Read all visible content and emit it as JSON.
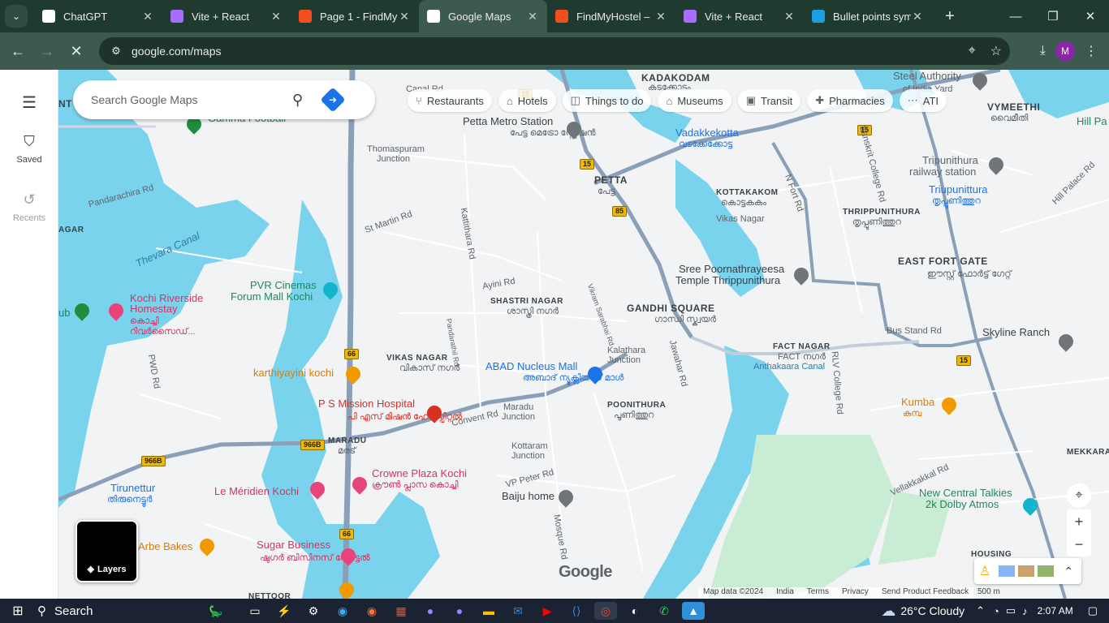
{
  "browser": {
    "tabs": [
      {
        "title": "ChatGPT",
        "favicon": "chatgpt-icon",
        "color": "#ffffff",
        "active": false
      },
      {
        "title": "Vite + React",
        "favicon": "vite-icon",
        "color": "#a86bff",
        "active": false
      },
      {
        "title": "Page 1 - FindMy",
        "favicon": "figma-icon",
        "color": "#f24e1e",
        "active": false
      },
      {
        "title": "Google Maps",
        "favicon": "maps-icon",
        "color": "#ffffff",
        "active": true
      },
      {
        "title": "FindMyHostel –",
        "favicon": "figma-icon",
        "color": "#f24e1e",
        "active": false
      },
      {
        "title": "Vite + React",
        "favicon": "vite-icon",
        "color": "#a86bff",
        "active": false
      },
      {
        "title": "Bullet points sym",
        "favicon": "s-icon",
        "color": "#1ba1e2",
        "active": false
      }
    ],
    "url": "google.com/maps",
    "profile_initial": "M"
  },
  "sidebar": {
    "saved_label": "Saved",
    "recents_label": "Recents"
  },
  "search": {
    "placeholder": "Search Google Maps"
  },
  "chips": [
    {
      "label": "Restaurants",
      "icon": "fork-knife-icon"
    },
    {
      "label": "Hotels",
      "icon": "bed-icon"
    },
    {
      "label": "Things to do",
      "icon": "camera-icon"
    },
    {
      "label": "Museums",
      "icon": "museum-icon"
    },
    {
      "label": "Transit",
      "icon": "train-icon"
    },
    {
      "label": "Pharmacies",
      "icon": "pill-icon"
    },
    {
      "label": "ATI",
      "icon": "dots-icon"
    }
  ],
  "map_labels": {
    "kadakodam": "KADAKODAM",
    "kadakodam_ml": "കടക്കോടം",
    "steel_authority": "Steel Authority",
    "steel_authority2": "of India Yard",
    "vymeethi": "VYMEETHI",
    "vymeethi_ml": "വൈമീതി",
    "hill_pa": "Hill Pa",
    "canal_rd": "Canal Rd",
    "petta_metro": "Petta Metro Station",
    "petta_metro_ml": "പേട്ട മെട്രോ സ്റ്റേഷൻ",
    "vadakkekotta": "Vadakkekotta",
    "vadakkekotta_ml": "വടക്കേക്കോട്ട",
    "gamma_football": "Gamma Football",
    "thomaspuram": "Thomaspuram",
    "junction": "Junction",
    "petta": "PETTA",
    "petta_ml": "പേട്ട",
    "kottakakom": "KOTTAKAKOM",
    "kottakakom_ml": "കൊട്ടകകം",
    "tripunithura_rly": "Tripunithura",
    "railway_station": "railway station",
    "tripunittura": "Triupunittura",
    "tripunittura_ml": "തൃപ്പൂണിത്തുറ",
    "thrippunithura": "THRIPPUNITHURA",
    "thrippunithura_ml": "തൃപ്പൂണിത്തുറ",
    "pandarachira": "Pandarachira Rd",
    "thevara_canal": "Thevara Canal",
    "east_fort_gate": "EAST FORT GATE",
    "east_fort_gate_ml": "ഈസ്റ്റ് ഫോർട്ട് ഗേറ്റ്",
    "sree_poornathrayeesa": "Sree Poornathrayeesa",
    "temple_thrippunithura": "Temple Thrippunithura",
    "pvr_cinemas": "PVR Cinemas",
    "forum_mall": "Forum Mall Kochi",
    "kochi_riverside": "Kochi Riverside",
    "homestay": "Homestay",
    "kochi_riverside_ml": "കൊച്ചി",
    "kochi_riverside_ml2": "റിവർസൈഡ്...",
    "shastri_nagar": "SHASTRI NAGAR",
    "shastri_nagar_ml": "ശാസ്ത്രി നഗർ",
    "gandhi_square": "GANDHI SQUARE",
    "gandhi_square_ml": "ഗാന്ധി സ്ക്വയർ",
    "bus_stand_rd": "Bus Stand Rd",
    "skyline_ranch": "Skyline Ranch",
    "fact_nagar": "FACT NAGAR",
    "fact_nagar_ml": "FACT നഗർ",
    "vikas_nagar": "VIKAS NAGAR",
    "vikas_nagar_ml": "വികാസ് നഗർ",
    "abad_nucleus": "ABAD Nucleus Mall",
    "abad_nucleus_ml": "അബാദ് ന്യൂക്ലിയസ് മാൾ",
    "kalathara": "Kalathara",
    "karthiyayini": "karthiyayini kochi",
    "ps_mission": "P S Mission Hospital",
    "ps_mission_ml": "പി എസ് മിഷൻ ഹോസ്പിറ്റൽ",
    "maradu_junction": "Maradu",
    "poonithura": "POONITHURA",
    "poonithura_ml": "പൂണിത്തുറ",
    "kumba": "Kumba",
    "kumba_ml": "കുമ്പ",
    "maradu": "MARADU",
    "maradu_ml": "മരട്",
    "kottaram": "Kottaram",
    "crowne_plaza": "Crowne Plaza Kochi",
    "crowne_plaza_ml": "ക്രൗൺ പ്ലാസ കൊച്ചി",
    "tirunettur": "Tirunettur",
    "tirunettur_ml": "തിരുനെട്ടൂർ",
    "le_meridien": "Le Méridien Kochi",
    "baiju_home": "Baiju home",
    "new_central": "New Central Talkies",
    "dolby": "2k Dolby Atmos",
    "mekkara": "MEKKARA",
    "arbe_bakes": "Arbe Bakes",
    "sugar_business": "Sugar Business",
    "sugar_business_ml": "ഷുഗർ ബിസിനസ് ഹോട്ടൽ",
    "housing": "HOUSING",
    "nettoor": "NETTOOR",
    "anthakaara_canal": "Anthakaara Canal",
    "convent_rd": "Convent Rd",
    "ayini_rd": "Ayini Rd",
    "st_martin": "St Martin Rd",
    "kattithara": "Kattithara Rd",
    "vp_peter": "VP Peter Rd",
    "vikas_nagar_rd": "Vikas Nagar",
    "rlv_college": "RLV College Rd",
    "n_fort_rd": "N Fort Rd",
    "sanskrit_college": "Sanskrit College Rd",
    "hill_palace_rd": "Hill Palace Rd",
    "vellakkakkal": "Vellakkakkal Rd",
    "pwd_rd": "PWD Rd",
    "sub": "ub",
    "agar": "AGAR",
    "nt": "NT",
    "mosque_rd": "Mosque Rd",
    "jawahar_rd": "Jawahar Rd",
    "pandarachira2": "Pandarathil Rd",
    "vikram_sarabhai": "Vikram Sarabhai Rd"
  },
  "shields": {
    "nh15": "15",
    "nh85": "85",
    "nh66": "66",
    "nh966b": "966B"
  },
  "map_controls": {
    "layers_label": "Layers",
    "google_logo": "Google",
    "footer": [
      "Map data ©2024",
      "India",
      "Terms",
      "Privacy",
      "Send Product Feedback"
    ],
    "scale": "500 m"
  },
  "taskbar": {
    "search_label": "Search",
    "weather": "26°C  Cloudy",
    "time": "2:07 AM"
  }
}
